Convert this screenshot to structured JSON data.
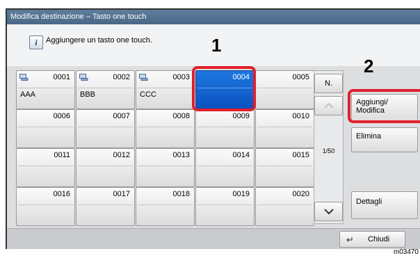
{
  "window": {
    "title": "Modifica destinazione – Tasto one touch"
  },
  "message": {
    "icon": "info-icon",
    "text": "Aggiungere un tasto one touch."
  },
  "keys": [
    {
      "number": "0001",
      "label": "AAA",
      "has_icon": true,
      "selected": false
    },
    {
      "number": "0002",
      "label": "BBB",
      "has_icon": true,
      "selected": false
    },
    {
      "number": "0003",
      "label": "CCC",
      "has_icon": true,
      "selected": false
    },
    {
      "number": "0004",
      "label": "",
      "has_icon": false,
      "selected": true
    },
    {
      "number": "0005",
      "label": "",
      "has_icon": false,
      "selected": false
    },
    {
      "number": "0006",
      "label": "",
      "has_icon": false,
      "selected": false
    },
    {
      "number": "0007",
      "label": "",
      "has_icon": false,
      "selected": false
    },
    {
      "number": "0008",
      "label": "",
      "has_icon": false,
      "selected": false
    },
    {
      "number": "0009",
      "label": "",
      "has_icon": false,
      "selected": false
    },
    {
      "number": "0010",
      "label": "",
      "has_icon": false,
      "selected": false
    },
    {
      "number": "0011",
      "label": "",
      "has_icon": false,
      "selected": false
    },
    {
      "number": "0012",
      "label": "",
      "has_icon": false,
      "selected": false
    },
    {
      "number": "0013",
      "label": "",
      "has_icon": false,
      "selected": false
    },
    {
      "number": "0014",
      "label": "",
      "has_icon": false,
      "selected": false
    },
    {
      "number": "0015",
      "label": "",
      "has_icon": false,
      "selected": false
    },
    {
      "number": "0016",
      "label": "",
      "has_icon": false,
      "selected": false
    },
    {
      "number": "0017",
      "label": "",
      "has_icon": false,
      "selected": false
    },
    {
      "number": "0018",
      "label": "",
      "has_icon": false,
      "selected": false
    },
    {
      "number": "0019",
      "label": "",
      "has_icon": false,
      "selected": false
    },
    {
      "number": "0020",
      "label": "",
      "has_icon": false,
      "selected": false
    }
  ],
  "scroll": {
    "number_button": "N.",
    "page": "1/50",
    "up_icon": "chevron-up-icon",
    "down_icon": "chevron-down-icon"
  },
  "actions": {
    "add_edit": "Aggiungi/\nModifica",
    "delete": "Elimina",
    "details": "Dettagli"
  },
  "footer": {
    "close": "Chiudi",
    "close_icon": "return-arrow-icon"
  },
  "annotations": {
    "step1": "1",
    "step2": "2",
    "image_code": "m03470"
  },
  "colors": {
    "selected_key": "#0a52c0",
    "highlight": "#e0202c",
    "titlebar": "#4a6787"
  }
}
